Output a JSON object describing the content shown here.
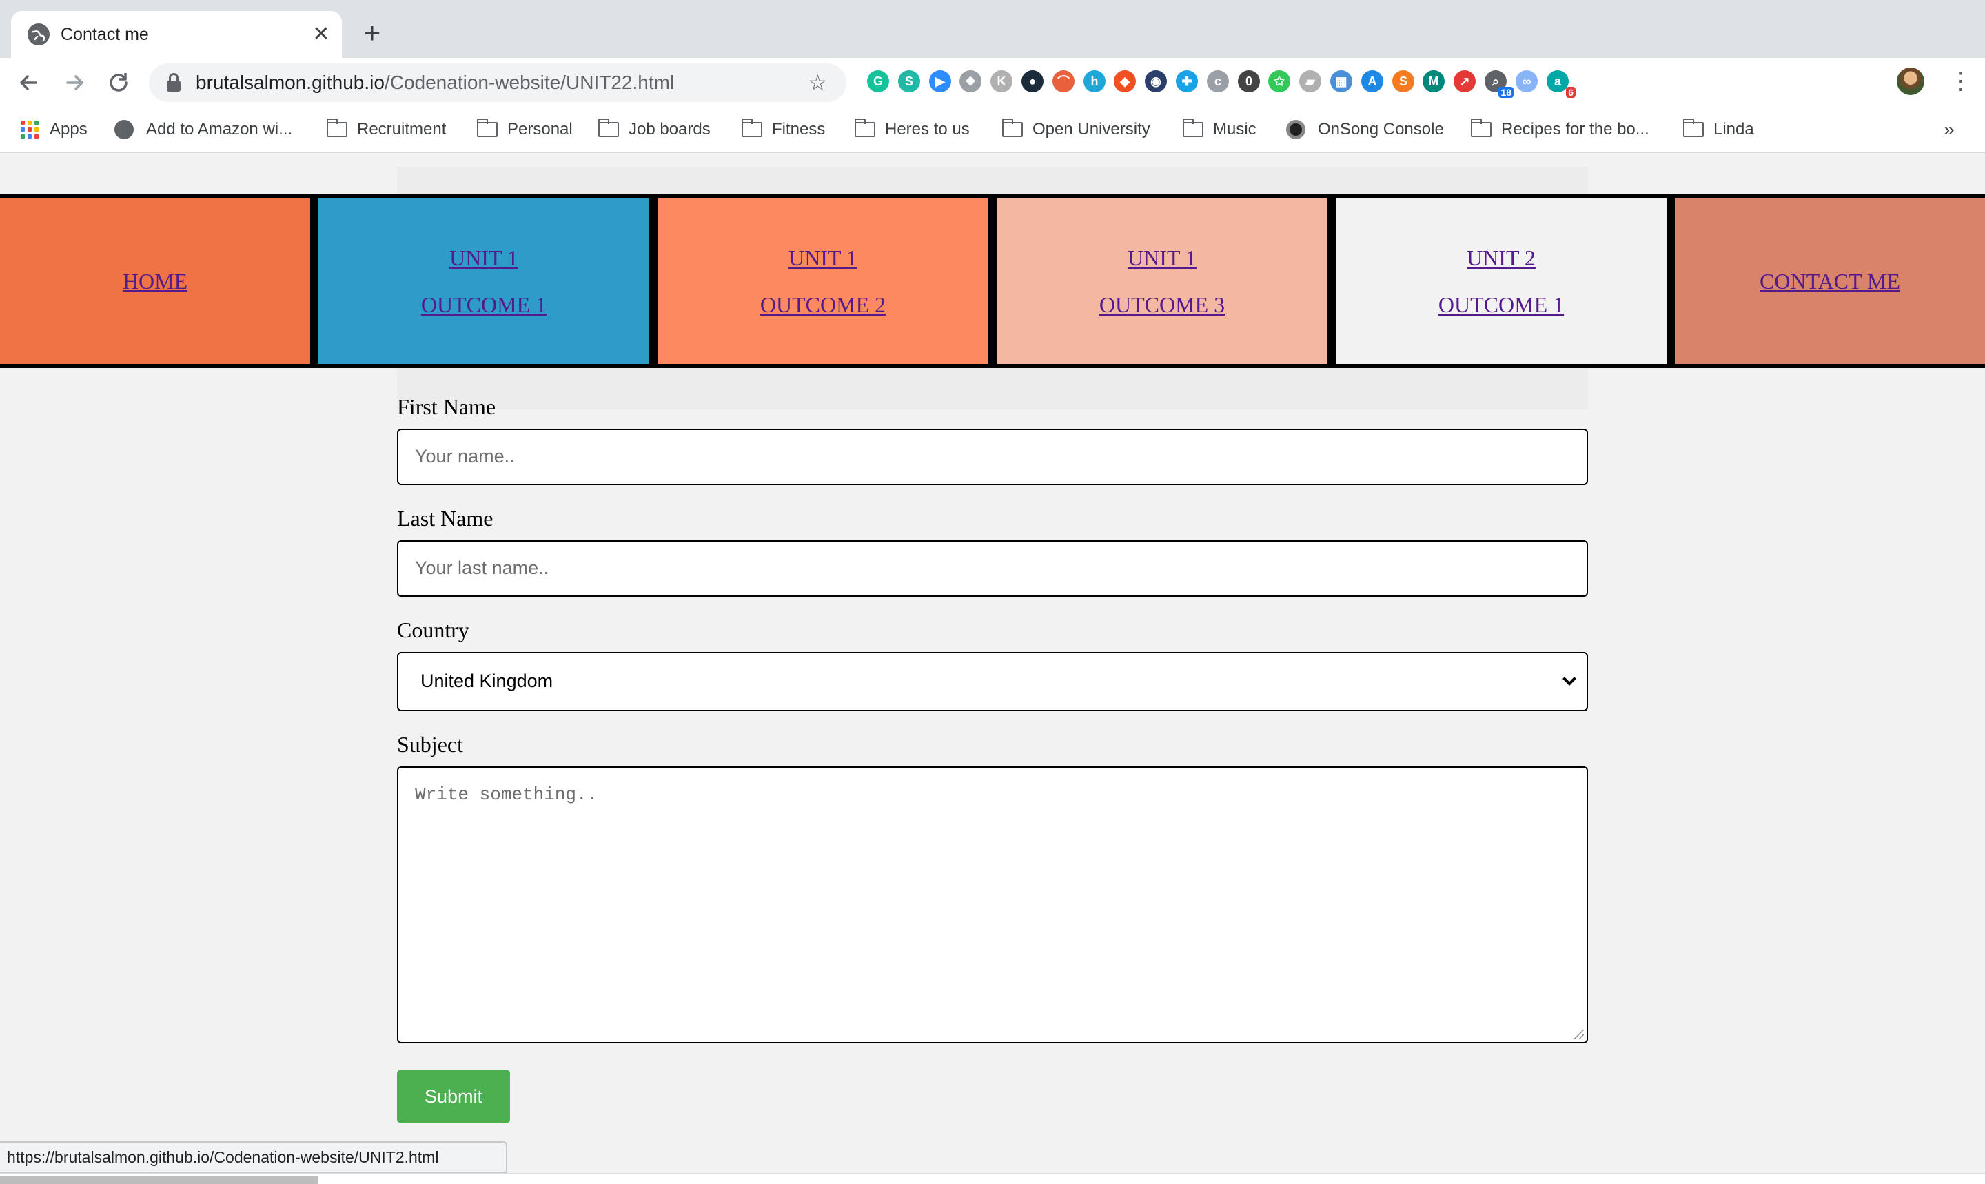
{
  "browser": {
    "tab_title": "Contact me",
    "tab_close": "✕",
    "new_tab": "+",
    "url_host": "brutalsalmon.github.io",
    "url_path": "/Codenation-website/UNIT22.html",
    "star": "☆",
    "menu": "⋮"
  },
  "extensions": [
    {
      "name": "grammarly-icon",
      "glyph": "G",
      "color": "#15c39a"
    },
    {
      "name": "extension-s-icon",
      "glyph": "S",
      "color": "#22b8a6"
    },
    {
      "name": "zoom-icon",
      "glyph": "▶",
      "color": "#2d8cff"
    },
    {
      "name": "dropbox-icon",
      "glyph": "❖",
      "color": "#9aa0a6"
    },
    {
      "name": "extension-k-icon",
      "glyph": "K",
      "color": "#b0b0b0"
    },
    {
      "name": "chat-bubble-icon",
      "glyph": "●",
      "color": "#1c2b3a"
    },
    {
      "name": "arc-icon",
      "glyph": "⌒",
      "color": "#e8613c"
    },
    {
      "name": "honey-icon",
      "glyph": "h",
      "color": "#1ea7d8"
    },
    {
      "name": "fox-icon",
      "glyph": "◆",
      "color": "#f25022"
    },
    {
      "name": "shield-ext-icon",
      "glyph": "◉",
      "color": "#2c3e6b"
    },
    {
      "name": "crosshair-icon",
      "glyph": "✚",
      "color": "#1aa3e8"
    },
    {
      "name": "clipboard-icon",
      "glyph": "c",
      "color": "#9aa0a6"
    },
    {
      "name": "zero-badge-icon",
      "glyph": "0",
      "color": "#444"
    },
    {
      "name": "star-circle-icon",
      "glyph": "✩",
      "color": "#34c759"
    },
    {
      "name": "note-icon",
      "glyph": "▰",
      "color": "#b0b0b0"
    },
    {
      "name": "map-icon",
      "glyph": "▦",
      "color": "#4a8fd8"
    },
    {
      "name": "compass-icon",
      "glyph": "A",
      "color": "#1e88e5"
    },
    {
      "name": "swirl-icon",
      "glyph": "S",
      "color": "#f47b20"
    },
    {
      "name": "hex-icon",
      "glyph": "M",
      "color": "#00897b"
    },
    {
      "name": "pdf-icon",
      "glyph": "↗",
      "color": "#e53935"
    },
    {
      "name": "search-badge-icon",
      "glyph": "⌕",
      "color": "#5f6368",
      "badge": "18",
      "badge_color": "#1a73e8"
    },
    {
      "name": "glasses-icon",
      "glyph": "∞",
      "color": "#8ab4f8"
    },
    {
      "name": "amazon-assistant-icon",
      "glyph": "a",
      "color": "#00a8a8",
      "badge": "6",
      "badge_color": "#e53935"
    }
  ],
  "bookmarks": [
    {
      "label": "Apps",
      "kind": "apps"
    },
    {
      "label": "Add to Amazon wi...",
      "kind": "globe"
    },
    {
      "label": "Recruitment",
      "kind": "folder"
    },
    {
      "label": "Personal",
      "kind": "folder"
    },
    {
      "label": "Job boards",
      "kind": "folder"
    },
    {
      "label": "Fitness",
      "kind": "folder"
    },
    {
      "label": "Heres to us",
      "kind": "folder"
    },
    {
      "label": "Open University",
      "kind": "folder"
    },
    {
      "label": "Music",
      "kind": "folder"
    },
    {
      "label": "OnSong Console",
      "kind": "onsong"
    },
    {
      "label": "Recipes for the bo...",
      "kind": "folder"
    },
    {
      "label": "Linda",
      "kind": "folder"
    }
  ],
  "bookmarks_more": "»",
  "nav": [
    {
      "lines": [
        "HOME"
      ],
      "color": "#f07346"
    },
    {
      "lines": [
        "UNIT 1",
        "OUTCOME 1"
      ],
      "color": "#2e9bc9"
    },
    {
      "lines": [
        "UNIT 1",
        "OUTCOME 2"
      ],
      "color": "#fd8a5e"
    },
    {
      "lines": [
        "UNIT 1",
        "OUTCOME 3"
      ],
      "color": "#f4b7a2"
    },
    {
      "lines": [
        "UNIT 2",
        "OUTCOME 1"
      ],
      "color": "#f2f2f2"
    },
    {
      "lines": [
        "CONTACT ME"
      ],
      "color": "#d8836a"
    }
  ],
  "form": {
    "first_name_label": "First Name",
    "first_name_placeholder": "Your name..",
    "last_name_label": "Last Name",
    "last_name_placeholder": "Your last name..",
    "country_label": "Country",
    "country_value": "United Kingdom",
    "subject_label": "Subject",
    "subject_placeholder": "Write something..",
    "submit_label": "Submit"
  },
  "status_url": "https://brutalsalmon.github.io/Codenation-website/UNIT2.html"
}
